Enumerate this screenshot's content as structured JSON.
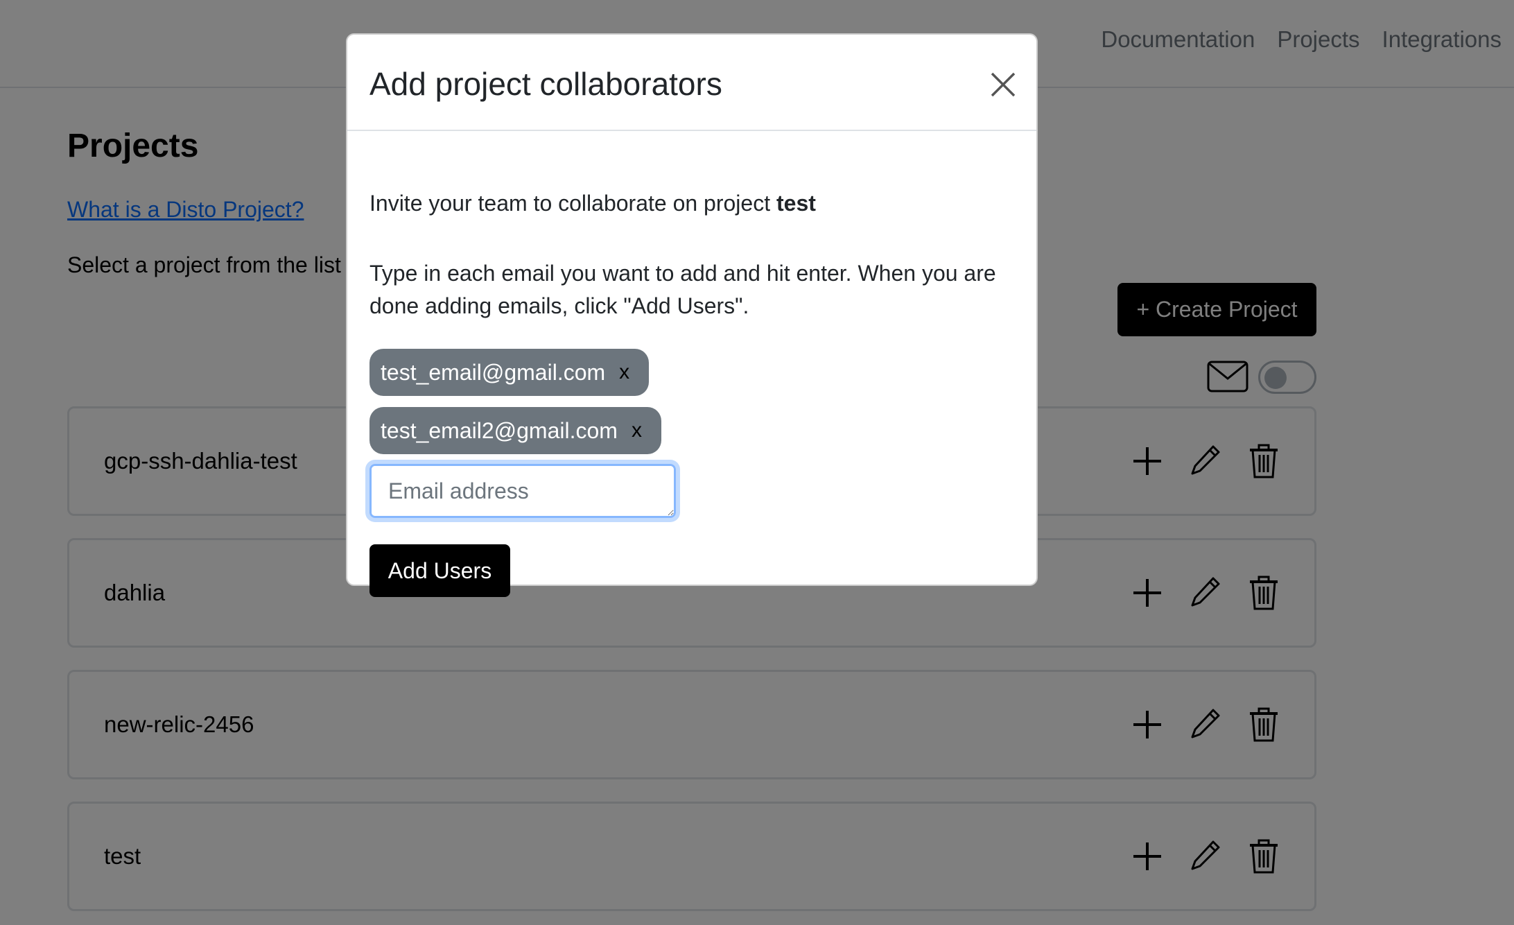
{
  "nav": {
    "links": [
      "Documentation",
      "Projects",
      "Integrations"
    ]
  },
  "page": {
    "title": "Projects",
    "help_link": "What is a Disto Project?",
    "subtitle": "Select a project from the list",
    "create_button": "+ Create Project"
  },
  "projects": [
    {
      "name": "gcp-ssh-dahlia-test"
    },
    {
      "name": "dahlia"
    },
    {
      "name": "new-relic-2456"
    },
    {
      "name": "test"
    }
  ],
  "modal": {
    "title": "Add project collaborators",
    "invite_text": "Invite your team to collaborate on project ",
    "project_name": "test",
    "instructions": "Type in each email you want to add and hit enter. When you are done adding emails, click \"Add Users\".",
    "chips": [
      {
        "email": "test_email@gmail.com",
        "remove": "x"
      },
      {
        "email": "test_email2@gmail.com",
        "remove": "x"
      }
    ],
    "input_placeholder": "Email address",
    "input_value": "",
    "submit_button": "Add Users"
  },
  "icons": {
    "close": "close-icon",
    "mail": "mail-icon",
    "add": "plus-icon",
    "edit": "pencil-icon",
    "delete": "trash-icon"
  },
  "colors": {
    "primary_button": "#000000",
    "chip_background": "#6c757d",
    "link": "#0d6efd",
    "input_focus": "#86b7fe",
    "backdrop": "rgba(0,0,0,0.5)"
  }
}
